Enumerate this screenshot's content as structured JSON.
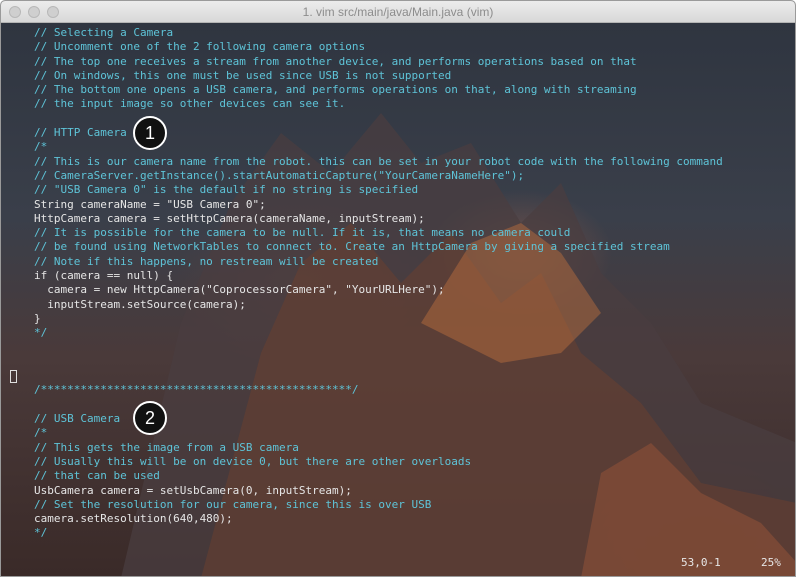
{
  "window": {
    "title": "1. vim src/main/java/Main.java (vim)"
  },
  "editor": {
    "lines": [
      {
        "text": "// Selecting a Camera",
        "kind": "comment"
      },
      {
        "text": "// Uncomment one of the 2 following camera options",
        "kind": "comment"
      },
      {
        "text": "// The top one receives a stream from another device, and performs operations based on that",
        "kind": "comment"
      },
      {
        "text": "// On windows, this one must be used since USB is not supported",
        "kind": "comment"
      },
      {
        "text": "// The bottom one opens a USB camera, and performs operations on that, along with streaming",
        "kind": "comment"
      },
      {
        "text": "// the input image so other devices can see it.",
        "kind": "comment"
      },
      {
        "text": "",
        "kind": "plain"
      },
      {
        "text": "// HTTP Camera",
        "kind": "comment"
      },
      {
        "text": "/*",
        "kind": "comment"
      },
      {
        "text": "// This is our camera name from the robot. this can be set in your robot code with the following command",
        "kind": "comment"
      },
      {
        "text": "// CameraServer.getInstance().startAutomaticCapture(\"YourCameraNameHere\");",
        "kind": "comment"
      },
      {
        "text": "// \"USB Camera 0\" is the default if no string is specified",
        "kind": "comment"
      },
      {
        "text": "String cameraName = \"USB Camera 0\";",
        "kind": "plain"
      },
      {
        "text": "HttpCamera camera = setHttpCamera(cameraName, inputStream);",
        "kind": "plain"
      },
      {
        "text": "// It is possible for the camera to be null. If it is, that means no camera could",
        "kind": "comment"
      },
      {
        "text": "// be found using NetworkTables to connect to. Create an HttpCamera by giving a specified stream",
        "kind": "comment"
      },
      {
        "text": "// Note if this happens, no restream will be created",
        "kind": "comment"
      },
      {
        "text": "if (camera == null) {",
        "kind": "plain"
      },
      {
        "text": "  camera = new HttpCamera(\"CoprocessorCamera\", \"YourURLHere\");",
        "kind": "plain"
      },
      {
        "text": "  inputStream.setSource(camera);",
        "kind": "plain"
      },
      {
        "text": "}",
        "kind": "plain"
      },
      {
        "text": "*/",
        "kind": "comment"
      },
      {
        "text": "",
        "kind": "plain"
      },
      {
        "text": "",
        "kind": "plain"
      },
      {
        "text": "",
        "kind": "plain"
      },
      {
        "text": "/***********************************************/",
        "kind": "comment"
      },
      {
        "text": "",
        "kind": "plain"
      },
      {
        "text": "// USB Camera",
        "kind": "comment"
      },
      {
        "text": "/*",
        "kind": "comment"
      },
      {
        "text": "// This gets the image from a USB camera",
        "kind": "comment"
      },
      {
        "text": "// Usually this will be on device 0, but there are other overloads",
        "kind": "comment"
      },
      {
        "text": "// that can be used",
        "kind": "comment"
      },
      {
        "text": "UsbCamera camera = setUsbCamera(0, inputStream);",
        "kind": "plain"
      },
      {
        "text": "// Set the resolution for our camera, since this is over USB",
        "kind": "comment"
      },
      {
        "text": "camera.setResolution(640,480);",
        "kind": "plain"
      },
      {
        "text": "*/",
        "kind": "comment"
      }
    ]
  },
  "status": {
    "position": "53,0-1",
    "percent": "25%"
  },
  "callouts": {
    "first": "1",
    "second": "2"
  }
}
